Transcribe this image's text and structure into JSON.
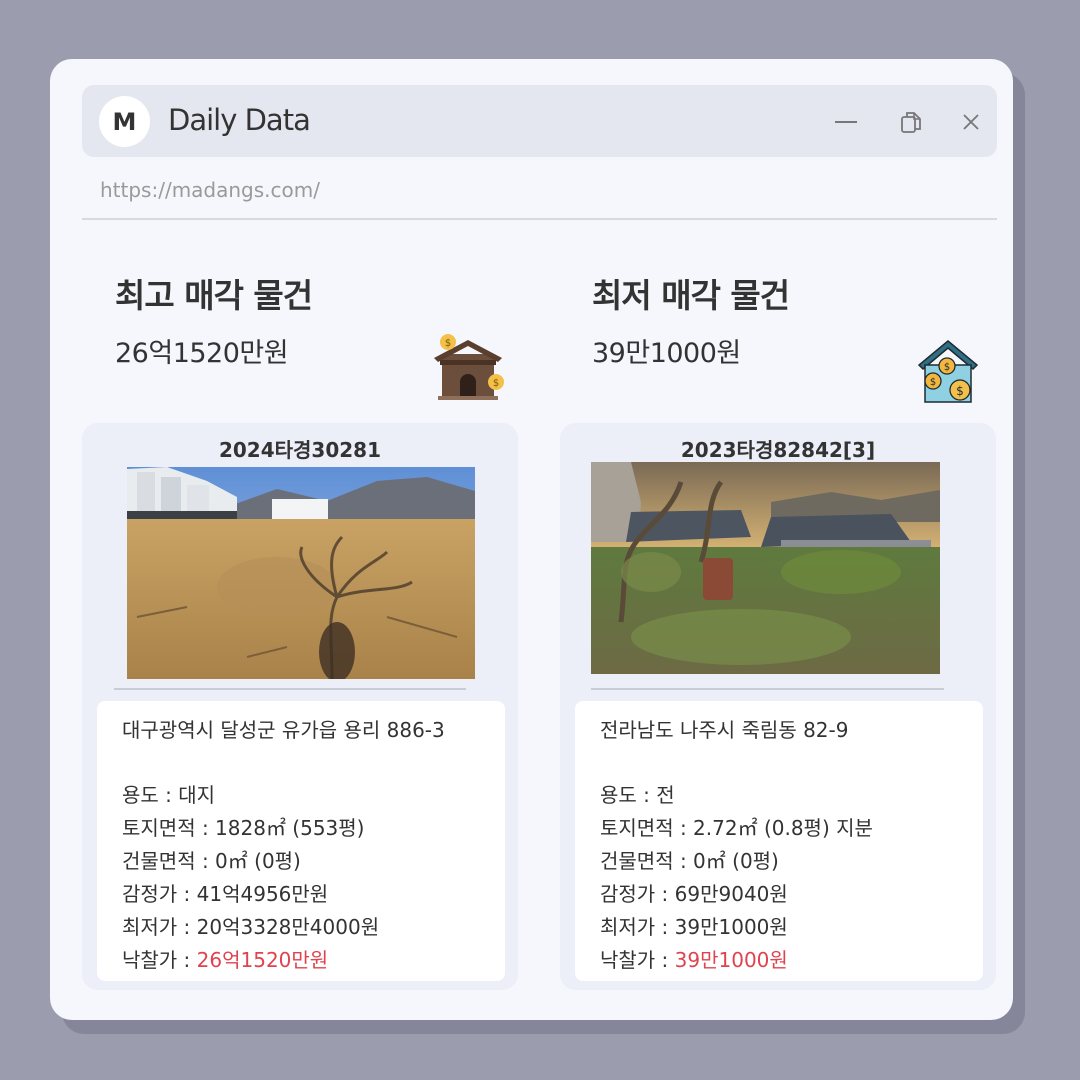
{
  "window": {
    "logo_letter": "M",
    "title": "Daily Data",
    "url": "https://madangs.com/"
  },
  "highest": {
    "heading": "최고 매각 물건",
    "price": "26억1520만원",
    "case_no": "2024타경30281",
    "address": "대구광역시 달성군 유가읍 용리 886-3",
    "details": {
      "usage": "용도 : 대지",
      "land_area": "토지면적 : 1828㎡ (553평)",
      "building_area": "건물면적 : 0㎡ (0평)",
      "appraisal": "감정가 : 41억4956만원",
      "minimum": "최저가 : 20억3328만4000원",
      "winning_label": "낙찰가 : ",
      "winning_value": "26억1520만원"
    },
    "icon": "house-money-icon"
  },
  "lowest": {
    "heading": "최저 매각 물건",
    "price": "39만1000원",
    "case_no": "2023타경82842[3]",
    "address": "전라남도 나주시 죽림동 82-9",
    "details": {
      "usage": "용도 : 전",
      "land_area": "토지면적 : 2.72㎡ (0.8평) 지분",
      "building_area": "건물면적 : 0㎡ (0평)",
      "appraisal": "감정가 : 69만9040원",
      "minimum": "최저가 : 39만1000원",
      "winning_label": "낙찰가 : ",
      "winning_value": "39만1000원"
    },
    "icon": "house-coins-icon"
  },
  "colors": {
    "accent_red": "#e0434f",
    "background": "#9b9cae",
    "window": "#f6f7fc"
  }
}
